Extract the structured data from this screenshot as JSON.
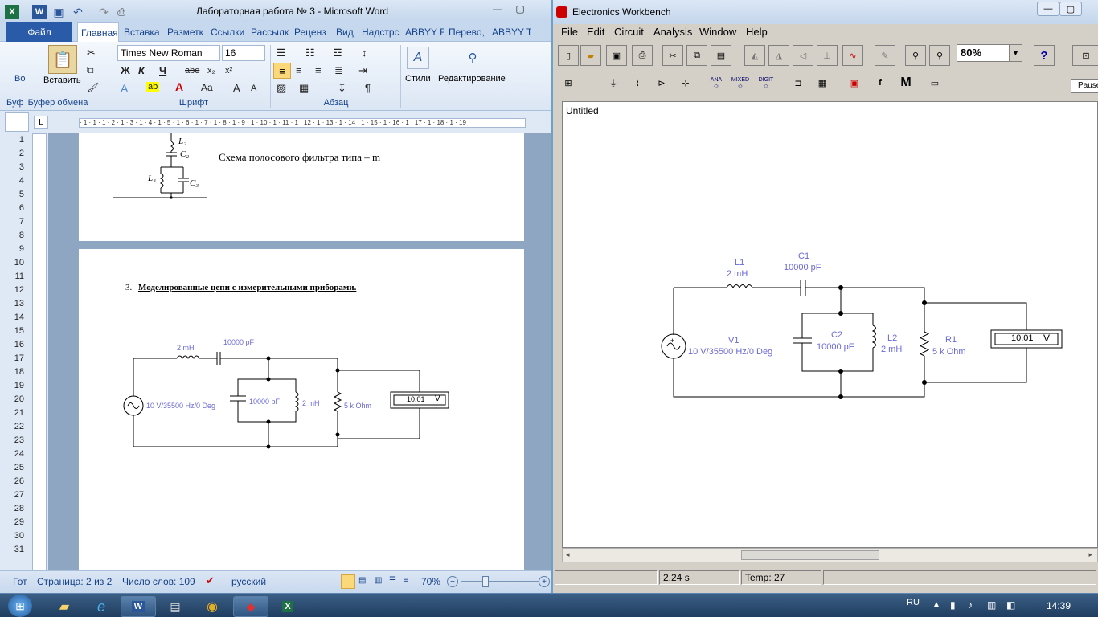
{
  "word": {
    "title": "Лабораторная работа № 3  -  Microsoft Word",
    "tabs": [
      "Файл",
      "Главная",
      "Вставка",
      "Разметк",
      "Ссылки",
      "Рассылк",
      "Реценз",
      "Вид",
      "Надстрс",
      "ABBYY Fi",
      "Перево,",
      "ABBYY Tr"
    ],
    "ribbon": {
      "paste_label": "Вставить",
      "clipboard_group": "Буфер обмена",
      "font_name": "Times New Roman",
      "font_size": "16",
      "font_group": "Шрифт",
      "paragraph_group": "Абзац",
      "styles_label": "Стили",
      "editing_label": "Редактирование",
      "left_cut_top": "Во",
      "left_cut_bottom": "Буф"
    },
    "ruler_marks": "· 1 · 1 · 1 · 2 · 1 · 3 · 1 · 4 · 1 · 5 · 1 · 6 · 1 · 7 · 1 · 8 · 1 · 9 · 1 · 10 · 1 · 11 · 1 · 12 · 1 · 13 · 1 · 14 · 1 · 15 · 1 · 16 · 1 · 17 · 1 · 18 · 1 · 19 ·",
    "line_numbers": [
      "1",
      "2",
      "3",
      "4",
      "5",
      "6",
      "7",
      "8",
      "9",
      "10",
      "11",
      "12",
      "13",
      "14",
      "15",
      "16",
      "17",
      "18",
      "19",
      "20",
      "21",
      "22",
      "23",
      "24",
      "25",
      "26",
      "27",
      "28",
      "29",
      "30",
      "31"
    ],
    "page1": {
      "caption": "Схема полосового фильтра типа – m",
      "l2": "L₂",
      "c2": "C₂",
      "l3": "L₃",
      "c3": "C₃"
    },
    "page2": {
      "heading_num": "3.",
      "heading_text": "Моделированные цепи с измерительными приборами.",
      "l_val": "2 mH",
      "c_val": "10000 pF",
      "v_val": "10 V/35500 Hz/0 Deg",
      "c2_val": "10000 pF",
      "l2_val": "2 mH",
      "r_val": "5 k Ohm",
      "meter_val": "10.01",
      "meter_unit": "V"
    },
    "status": {
      "page": "Страница: 2 из 2",
      "words": "Число слов: 109",
      "lang": "русский",
      "zoom": "70%",
      "left_cut": "Гот"
    }
  },
  "ewb": {
    "title": "Electronics Workbench",
    "menu": [
      "File",
      "Edit",
      "Circuit",
      "Analysis",
      "Window",
      "Help"
    ],
    "zoom": "80%",
    "pause_label": "Pause",
    "part_labels": {
      "ana": "ANA",
      "mixed": "MIXED",
      "digit": "DIGIT",
      "m": "M"
    },
    "canvas_title": "Untitled",
    "circuit": {
      "l1_name": "L1",
      "l1_val": "2 mH",
      "c1_name": "C1",
      "c1_val": "10000 pF",
      "v1_name": "V1",
      "v1_val": "10 V/35500 Hz/0 Deg",
      "c2_name": "C2",
      "c2_val": "10000 pF",
      "l2_name": "L2",
      "l2_val": "2 mH",
      "r1_name": "R1",
      "r1_val": "5 k Ohm",
      "meter_val": "10.01",
      "meter_unit": "V"
    },
    "status": {
      "time": "2.24 s",
      "temp": "Temp:  27"
    }
  },
  "taskbar": {
    "lang": "RU",
    "time": "14:39"
  },
  "colors": {
    "component_label": "#6a6ad6",
    "wire": "#000000",
    "word_blue": "#15428b"
  }
}
